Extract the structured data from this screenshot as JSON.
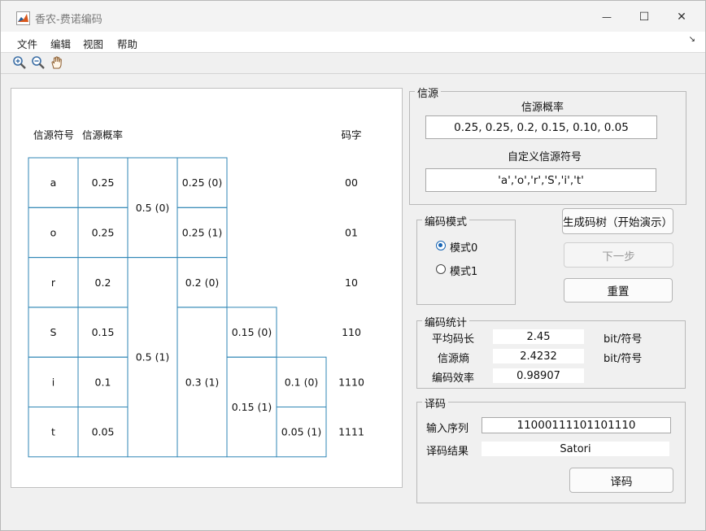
{
  "window": {
    "title": "香农-费诺编码",
    "controls": [
      "—",
      "☐",
      "✕"
    ]
  },
  "menu": [
    "文件",
    "编辑",
    "视图",
    "帮助"
  ],
  "menu_overflow": "↘",
  "toolbar": [
    {
      "icon": "zoom-in-icon"
    },
    {
      "icon": "zoom-out-icon"
    },
    {
      "icon": "pan-hand-icon"
    }
  ],
  "table": {
    "headers": {
      "symbol": "信源符号",
      "prob": "信源概率",
      "code": "码字"
    },
    "symbols": [
      "a",
      "o",
      "r",
      "S",
      "i",
      "t"
    ],
    "probs": [
      "0.25",
      "0.25",
      "0.2",
      "0.15",
      "0.1",
      "0.05"
    ],
    "codes": [
      "00",
      "01",
      "10",
      "110",
      "1110",
      "1111"
    ],
    "groups": [
      {
        "label": "0.5 (0)",
        "col": 2,
        "rows": [
          0,
          1
        ]
      },
      {
        "label": "0.5 (1)",
        "col": 2,
        "rows": [
          2,
          5
        ]
      },
      {
        "label": "0.25 (0)",
        "col": 3,
        "rows": [
          0,
          0
        ]
      },
      {
        "label": "0.25 (1)",
        "col": 3,
        "rows": [
          1,
          1
        ]
      },
      {
        "label": "0.2 (0)",
        "col": 3,
        "rows": [
          2,
          2
        ]
      },
      {
        "label": "0.3 (1)",
        "col": 3,
        "rows": [
          3,
          5
        ]
      },
      {
        "label": "0.15 (0)",
        "col": 4,
        "rows": [
          3,
          3
        ]
      },
      {
        "label": "0.15 (1)",
        "col": 4,
        "rows": [
          4,
          5
        ]
      },
      {
        "label": "0.1 (0)",
        "col": 5,
        "rows": [
          4,
          4
        ]
      },
      {
        "label": "0.05 (1)",
        "col": 5,
        "rows": [
          5,
          5
        ]
      }
    ]
  },
  "source_panel": {
    "title": "信源",
    "prob_label": "信源概率",
    "prob_value": "0.25, 0.25, 0.2, 0.15, 0.10, 0.05",
    "symbol_label": "自定义信源符号",
    "symbol_value": "'a','o','r','S','i','t'"
  },
  "mode_panel": {
    "title": "编码模式",
    "options": [
      "模式0",
      "模式1"
    ],
    "selected": 0
  },
  "buttons": {
    "generate": "生成码树（开始演示）",
    "next": "下一步",
    "reset": "重置",
    "decode": "译码"
  },
  "stats_panel": {
    "title": "编码统计",
    "avg_label": "平均码长",
    "avg_value": "2.45",
    "avg_unit": "bit/符号",
    "entropy_label": "信源熵",
    "entropy_value": "2.4232",
    "entropy_unit": "bit/符号",
    "eff_label": "编码效率",
    "eff_value": "0.98907"
  },
  "decode_panel": {
    "title": "译码",
    "input_label": "输入序列",
    "input_value": "11000111101101110",
    "result_label": "译码结果",
    "result_value": "Satori"
  },
  "colors": {
    "grid": "#2f86b5",
    "radio_selected": "#1664b4"
  }
}
